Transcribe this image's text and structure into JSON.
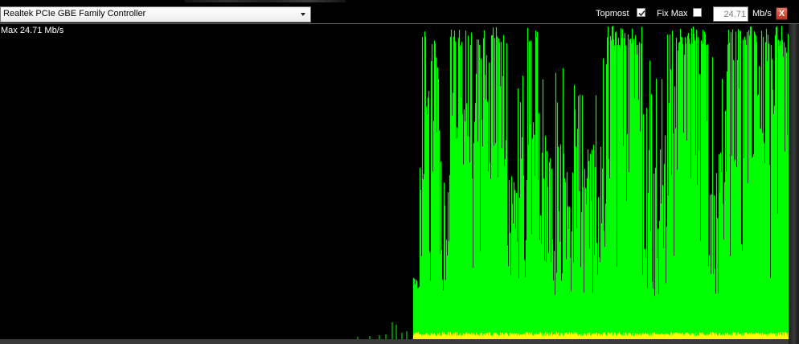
{
  "toolbar": {
    "adapter_value": "Realtek PCIe GBE Family Controller",
    "topmost_label": "Topmost",
    "topmost_checked": true,
    "fixmax_label": "Fix Max",
    "fixmax_checked": false,
    "max_value": "24.71",
    "unit_label": "Mb/s",
    "close_label": "X"
  },
  "graph": {
    "max_readout": "Max 24.71 Mb/s",
    "download_color": "#00ff00",
    "upload_color": "#ffff00",
    "background": "#000000"
  },
  "icons": {
    "dropdown": "chevron-down-icon",
    "check": "check-icon",
    "close": "close-icon"
  }
}
